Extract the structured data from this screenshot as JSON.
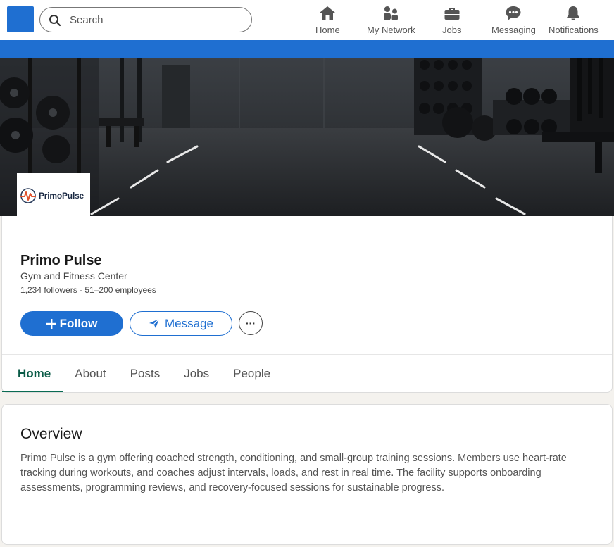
{
  "nav": {
    "search_placeholder": "Search",
    "items": [
      {
        "label": "Home",
        "icon": "home-icon"
      },
      {
        "label": "My Network",
        "icon": "people-icon"
      },
      {
        "label": "Jobs",
        "icon": "briefcase-icon"
      },
      {
        "label": "Messaging",
        "icon": "chat-icon"
      },
      {
        "label": "Notifications",
        "icon": "bell-icon"
      }
    ]
  },
  "company": {
    "logo_text": "PrimoPulse",
    "name": "Primo Pulse",
    "industry": "Gym and Fitness Center",
    "stats": "1,234 followers · 51–200 employees"
  },
  "actions": {
    "follow_label": "Follow",
    "message_label": "Message",
    "more_label": "···"
  },
  "tabs": [
    "Home",
    "About",
    "Posts",
    "Jobs",
    "People"
  ],
  "overview": {
    "title": "Overview",
    "text": "Primo Pulse is a gym offering coached strength, conditioning, and small-group training sessions. Members use heart-rate tracking during workouts, and coaches adjust intervals, loads, and rest in real time. The facility supports onboarding assessments, programming reviews, and recovery-focused sessions for sustainable progress."
  },
  "colors": {
    "brand_blue": "#1f6fd1",
    "active_tab": "#0a5b47",
    "page_bg": "#f4f2ee"
  }
}
